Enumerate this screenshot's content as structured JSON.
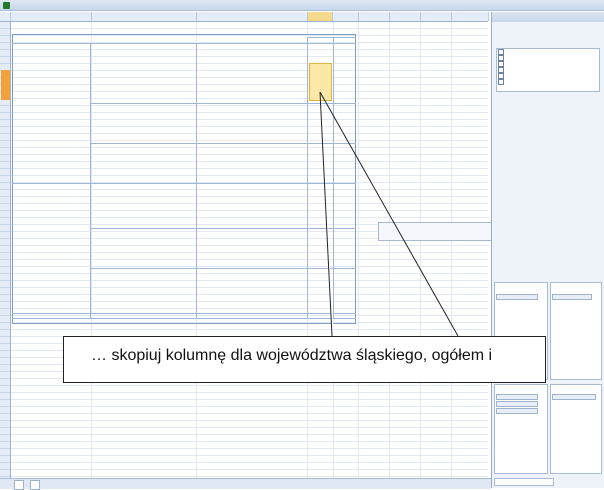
{
  "caption": {
    "text": "… skopiuj kolumnę dla województwa śląskiego, ogółem i"
  },
  "colors": {
    "highlight_fill": "#fbe8a6",
    "highlight_border": "#e0b33a",
    "row_tab": "#f2a23a",
    "panel_bg": "#eef3fa",
    "header_bg": "#e4ecf7"
  },
  "window": {
    "app_icon": "excel-icon"
  }
}
